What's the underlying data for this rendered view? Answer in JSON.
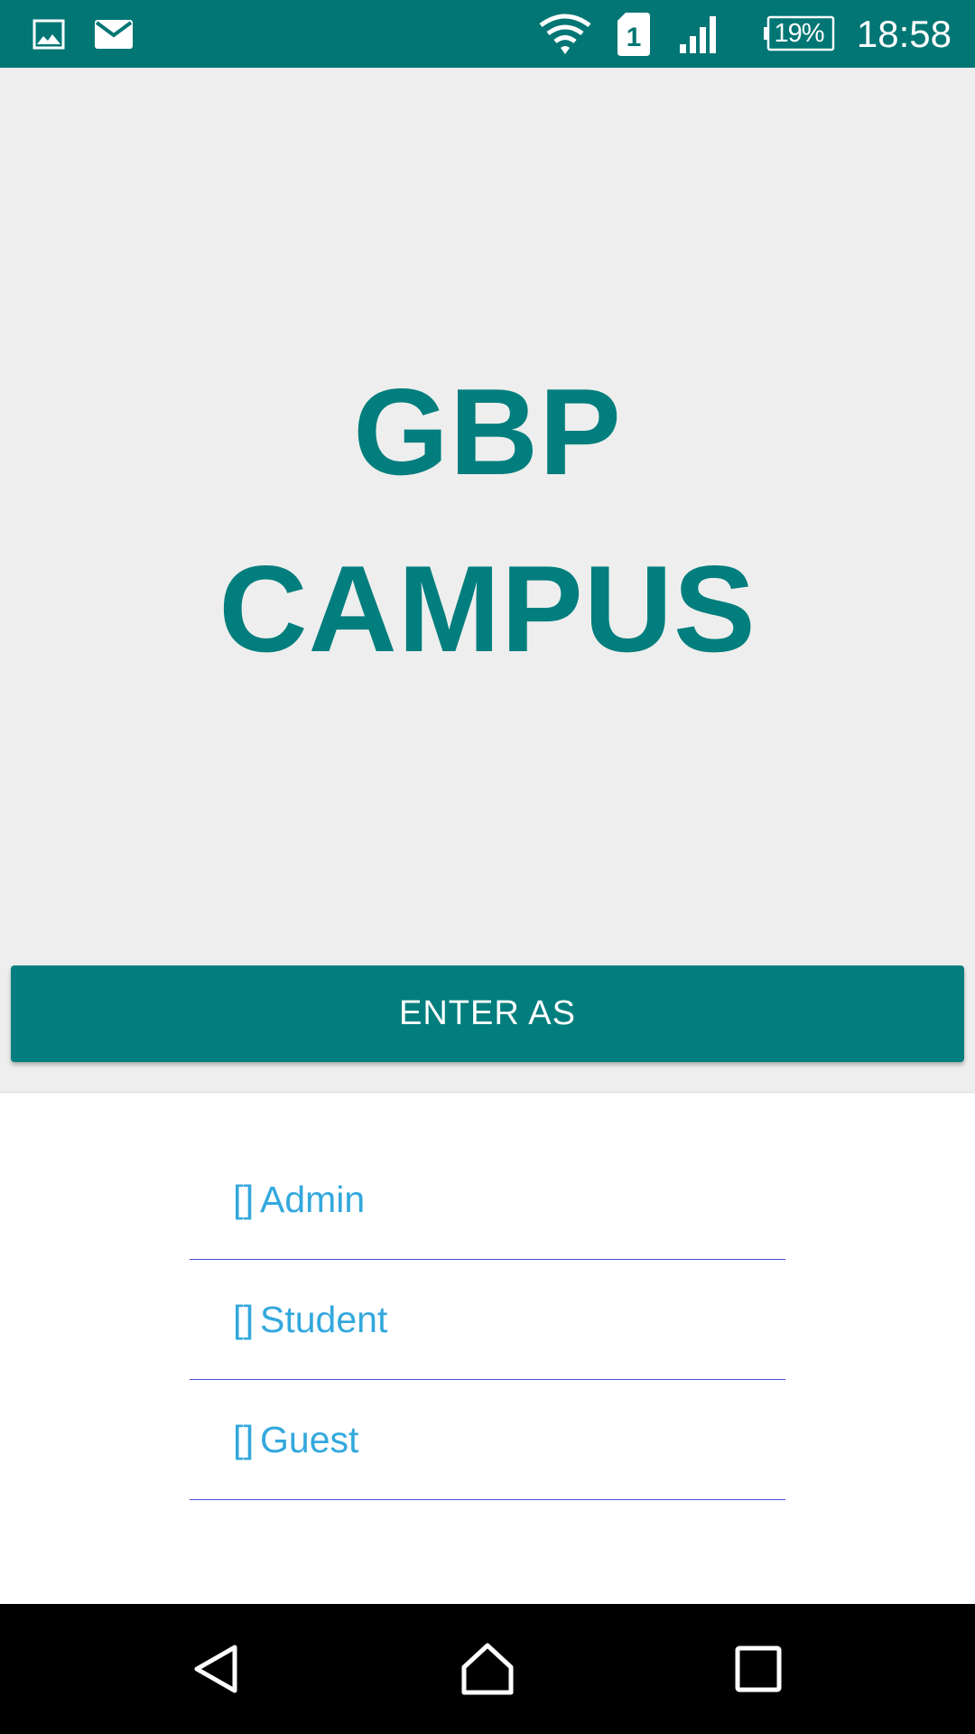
{
  "status_bar": {
    "time": "18:58",
    "battery": "19%",
    "sim_slot": "1",
    "icons": [
      "image-icon",
      "mail-icon",
      "wifi-icon",
      "sim-icon",
      "signal-icon",
      "battery-icon"
    ]
  },
  "hero": {
    "line1": "GBP",
    "line2": "CAMPUS"
  },
  "enter_button": {
    "label": "ENTER AS"
  },
  "roles": [
    {
      "checkbox": "[]",
      "label": "Admin"
    },
    {
      "checkbox": "[]",
      "label": "Student"
    },
    {
      "checkbox": "[]",
      "label": "Guest"
    }
  ],
  "nav_bar": {
    "icons": [
      "back-icon",
      "home-icon",
      "recents-icon"
    ]
  },
  "colors": {
    "status_bar": "#017674",
    "accent": "#017e7d",
    "role_text": "#33a8dd",
    "divider": "#4a4adf",
    "background": "#eeeeee"
  }
}
